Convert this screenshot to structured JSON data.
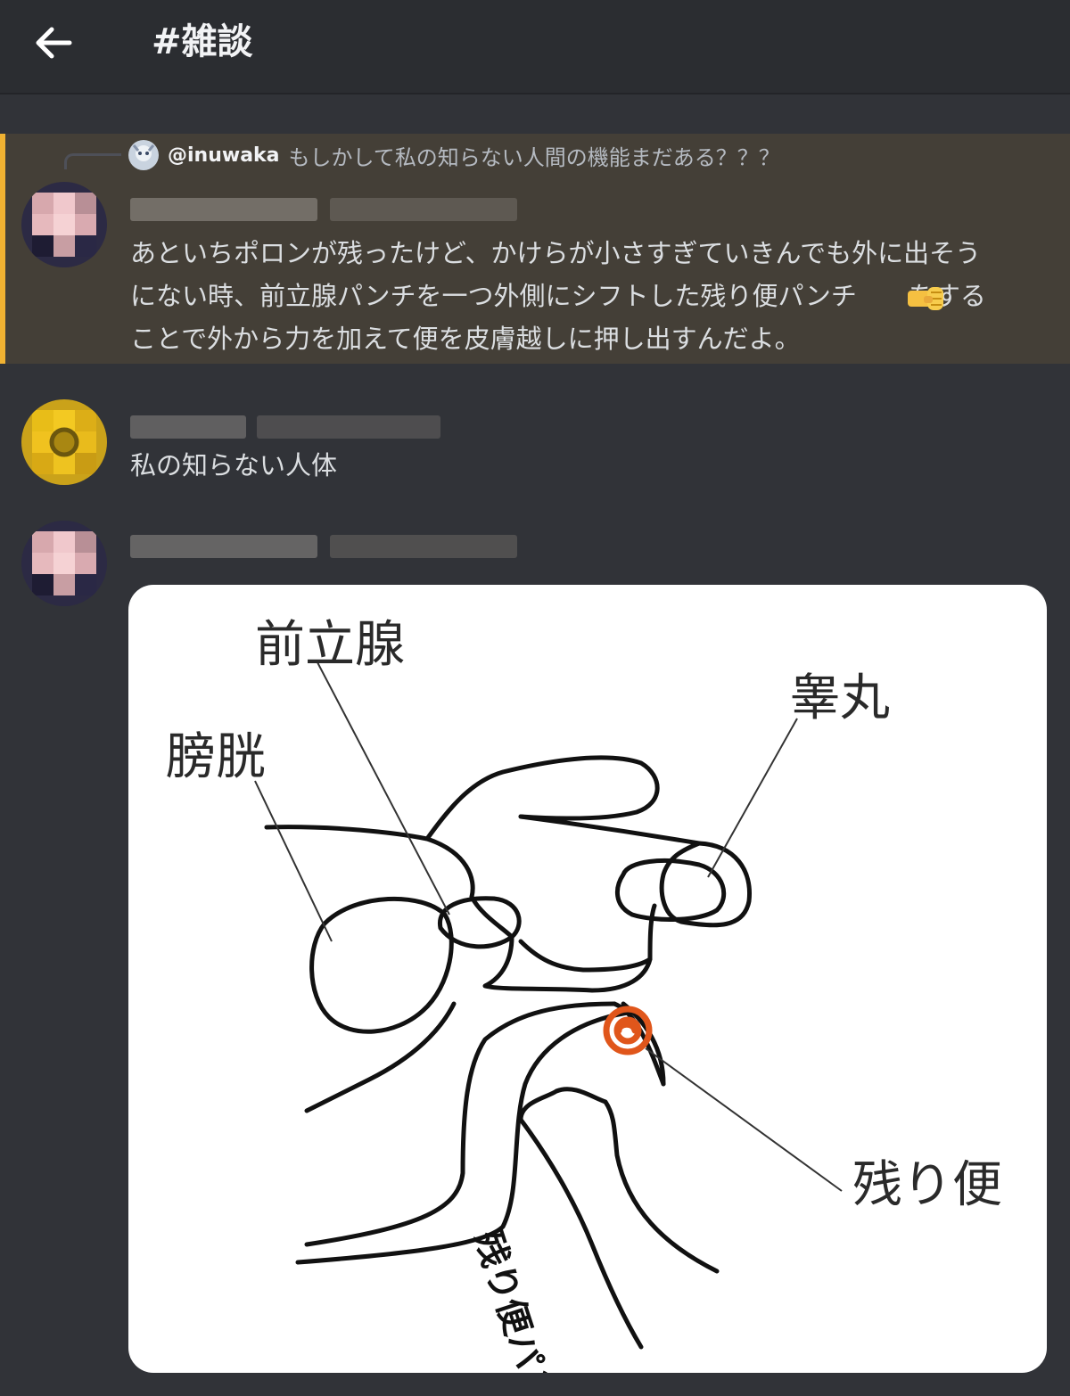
{
  "header": {
    "channel_title": "#雑談"
  },
  "messages": [
    {
      "reply": {
        "username": "@inuwaka",
        "text": "もしかして私の知らない人間の機能まだある？？？"
      },
      "text": "あといちポロンが残ったけど、かけらが小さすぎていきんでも外に出そう\nにない時、前立腺パンチを一つ外側にシフトした残り便パンチ　　をする\nことで外から力を加えて便を皮膚越しに押し出すんだよ。",
      "emoji": "fist-emoji",
      "highlighted": true
    },
    {
      "text": "私の知らない人体"
    },
    {
      "image": {
        "labels": {
          "prostate": "前立腺",
          "bladder": "膀胱",
          "testis": "睾丸",
          "residual_stool": "残り便",
          "punch_text": "残り便パンチ"
        }
      }
    }
  ],
  "colors": {
    "mention_bar": "#f0b232",
    "highlight_bg": "#443f37",
    "stool": "#e0561b"
  }
}
